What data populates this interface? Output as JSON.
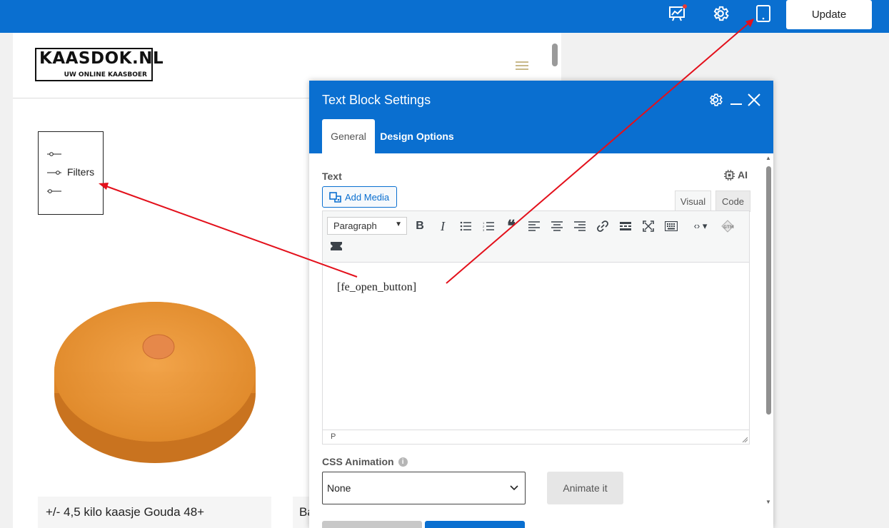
{
  "topbar": {
    "icons": [
      "analytics-icon",
      "gear-icon",
      "tablet-icon"
    ],
    "update_label": "Update",
    "colors": {
      "bar": "#0a6fd0",
      "notification_dot": "#e53935"
    }
  },
  "page": {
    "logo": {
      "title": "KAASDOK.NL",
      "tagline": "UW ONLINE KAASBOER"
    },
    "filter": {
      "label": "Filters"
    },
    "products": [
      {
        "title": "+/- 4,5 kilo kaasje Gouda 48+"
      },
      {
        "title": "Ba"
      }
    ]
  },
  "modal": {
    "title": "Text Block Settings",
    "tabs": [
      {
        "label": "General",
        "active": true
      },
      {
        "label": "Design Options",
        "active": false
      }
    ],
    "text_label": "Text",
    "ai_label": "AI",
    "add_media_label": "Add Media",
    "editor_modes": {
      "visual": "Visual",
      "code": "Code"
    },
    "format_select": "Paragraph",
    "content": "[fe_open_button]",
    "status_path": "P",
    "css_animation": {
      "label": "CSS Animation",
      "selected": "None",
      "animate_button": "Animate it"
    }
  }
}
